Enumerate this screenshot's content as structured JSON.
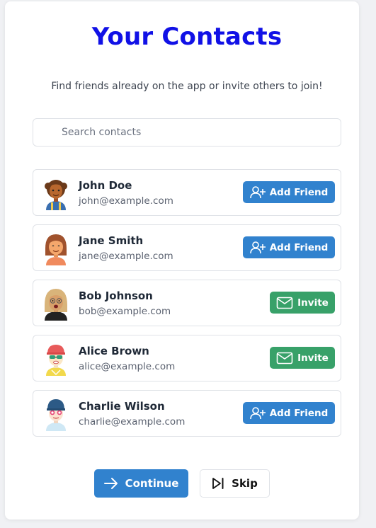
{
  "header": {
    "title": "Your Contacts",
    "subtitle": "Find friends already on the app or invite others to join!"
  },
  "search": {
    "placeholder": "Search contacts",
    "value": ""
  },
  "contacts": [
    {
      "name": "John Doe",
      "email": "john@example.com",
      "action": "Add Friend",
      "action_type": "add",
      "avatar": "avatar-curly-hair"
    },
    {
      "name": "Jane Smith",
      "email": "jane@example.com",
      "action": "Add Friend",
      "action_type": "add",
      "avatar": "avatar-bob-hair"
    },
    {
      "name": "Bob Johnson",
      "email": "bob@example.com",
      "action": "Invite",
      "action_type": "invite",
      "avatar": "avatar-blonde-glasses"
    },
    {
      "name": "Alice Brown",
      "email": "alice@example.com",
      "action": "Invite",
      "action_type": "invite",
      "avatar": "avatar-red-hat"
    },
    {
      "name": "Charlie Wilson",
      "email": "charlie@example.com",
      "action": "Add Friend",
      "action_type": "add",
      "avatar": "avatar-blue-hat"
    }
  ],
  "footer": {
    "continue_label": "Continue",
    "skip_label": "Skip"
  },
  "colors": {
    "title": "#1111e6",
    "add_button": "#3182ce",
    "invite_button": "#38a169",
    "continue_button": "#3182ce"
  }
}
